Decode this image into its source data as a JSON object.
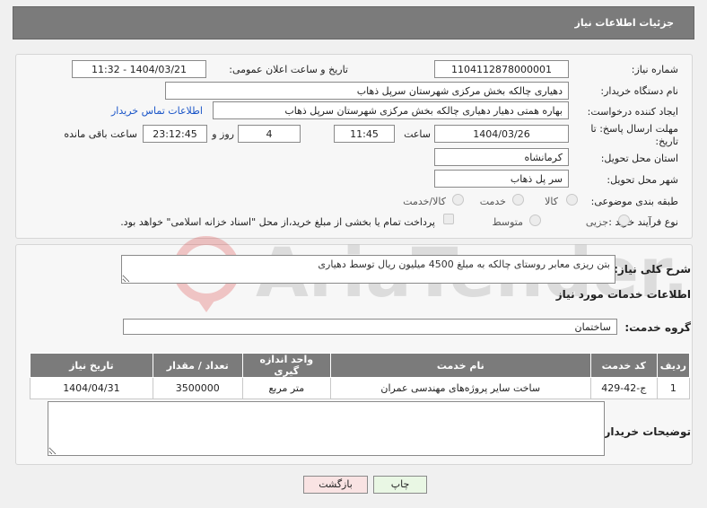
{
  "header": {
    "title": "جزئیات اطلاعات نیاز"
  },
  "fields": {
    "need_number_label": "شماره نیاز:",
    "need_number": "1104112878000001",
    "announce_label": "تاریخ و ساعت اعلان عمومی:",
    "announce_value": "1404/03/21 - 11:32",
    "buyer_org_label": "نام دستگاه خریدار:",
    "buyer_org": "دهیاری چالکه بخش مرکزی شهرستان سرپل ذهاب",
    "creator_label": "ایجاد کننده درخواست:",
    "creator": "بهاره همتی دهیار دهیاری چالکه بخش مرکزی شهرستان سرپل ذهاب",
    "contact_link": "اطلاعات تماس خریدار",
    "deadline_label": "مهلت ارسال پاسخ: تا تاریخ:",
    "deadline_date": "1404/03/26",
    "time_label": "ساعت",
    "deadline_time": "11:45",
    "days_value": "4",
    "days_label": "روز و",
    "remaining_time": "23:12:45",
    "remaining_label": "ساعت باقی مانده",
    "province_label": "استان محل تحویل:",
    "province": "کرمانشاه",
    "city_label": "شهر محل تحویل:",
    "city": "سر پل ذهاب",
    "category_label": "طبقه بندی موضوعی:",
    "category_options": [
      "کالا",
      "خدمت",
      "کالا/خدمت"
    ],
    "process_label": "نوع فرآیند خرید :",
    "process_options": [
      "جزیی",
      "متوسط"
    ],
    "payment_note": "پرداخت تمام یا بخشی از مبلغ خرید،از محل \"اسناد خزانه اسلامی\" خواهد بود."
  },
  "details": {
    "summary_label": "شرح کلی نیاز:",
    "summary_text": "بتن ریزی معابر روستای چالکه به مبلغ 4500 میلیون ریال توسط دهیاری",
    "services_title": "اطلاعات خدمات مورد نیاز",
    "service_group_label": "گروه خدمت:",
    "service_group": "ساختمان",
    "buyer_notes_label": "توضیحات خریدار:"
  },
  "table": {
    "headers": [
      "ردیف",
      "کد خدمت",
      "نام خدمت",
      "واحد اندازه گیری",
      "تعداد / مقدار",
      "تاریخ نیاز"
    ],
    "rows": [
      [
        "1",
        "ج-42-429",
        "ساخت سایر پروژه‌های مهندسی عمران",
        "متر مربع",
        "3500000",
        "1404/04/31"
      ]
    ]
  },
  "buttons": {
    "print": "چاپ",
    "back": "بازگشت"
  },
  "colors": {
    "header_bg": "#7b7b7b",
    "link": "#1a55c8",
    "print_bg": "#e9f7e4",
    "back_bg": "#f9e3e3"
  }
}
